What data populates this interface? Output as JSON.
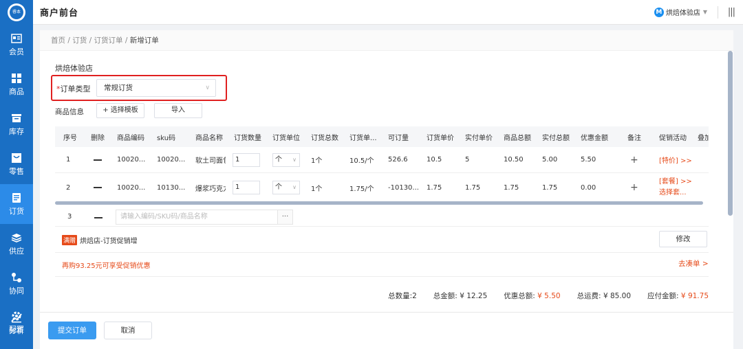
{
  "app": {
    "logo_text": "睿本",
    "title": "商户前台",
    "store_badge": "M",
    "store_name": "烘焙体验店"
  },
  "sidebar": {
    "items": [
      {
        "label": "会员",
        "icon": "member-icon"
      },
      {
        "label": "商品",
        "icon": "goods-icon"
      },
      {
        "label": "库存",
        "icon": "stock-icon"
      },
      {
        "label": "零售",
        "icon": "retail-icon"
      },
      {
        "label": "订货",
        "icon": "order-icon",
        "active": true
      },
      {
        "label": "供应",
        "icon": "supply-icon"
      },
      {
        "label": "协同",
        "icon": "collab-icon"
      },
      {
        "label": "分析",
        "icon": "analysis-icon"
      }
    ],
    "bottom": {
      "label": "配置",
      "icon": "gear-icon"
    }
  },
  "breadcrumb": {
    "home": "首页",
    "sep": "/",
    "order": "订货",
    "order_list": "订货订单",
    "current": "新增订单"
  },
  "form": {
    "store_name": "烘焙体验店",
    "order_type_required": "*",
    "order_type_label": "订单类型",
    "order_type_value": "常规订货",
    "goods_label": "商品信息",
    "template_button": "+ 选择模板",
    "import_button": "导入"
  },
  "table": {
    "headers": [
      "序号",
      "删除",
      "商品编码",
      "sku码",
      "商品名称",
      "订货数量",
      "订货单位",
      "订货总数",
      "订货单...",
      "可订量",
      "订货单价",
      "实付单价",
      "商品总额",
      "实付总额",
      "优惠金额",
      "备注",
      "促销活动",
      "叠加促"
    ],
    "rows": [
      {
        "index": "1",
        "code": "10020...",
        "sku": "10020...",
        "name": "软土司面包",
        "qty": "1",
        "unit": "个",
        "total": "1个",
        "unit_desc": "10.5/个",
        "available": "526.6",
        "price": "10.5",
        "paid_price": "5",
        "goods_total": "10.50",
        "paid_total": "5.00",
        "discount": "5.50",
        "remark": "+",
        "promo1": "[特价] >>",
        "promo2": ""
      },
      {
        "index": "2",
        "code": "10020...",
        "sku": "10130...",
        "name": "爆浆巧克力",
        "qty": "1",
        "unit": "个",
        "total": "1个",
        "unit_desc": "1.75/个",
        "available": "-10130...",
        "price": "1.75",
        "paid_price": "1.75",
        "goods_total": "1.75",
        "paid_total": "1.75",
        "discount": "0.00",
        "remark": "+",
        "promo1": "[套餐] >>",
        "promo2": "选择套..."
      }
    ],
    "new_row": {
      "index": "3",
      "placeholder": "请输入编码/SKU码/商品名称",
      "more": "..."
    }
  },
  "promotion": {
    "badge": "满赠",
    "text": "烘焙店-订货促销增",
    "modify_button": "修改",
    "rebuy_text": "再购93.25元可享受促销优惠",
    "go_collect": "去凑单 >"
  },
  "totals": {
    "qty": "总数量:2",
    "amount_label": "总金额:",
    "amount": "¥ 12.25",
    "discount_label": "优惠总额:",
    "discount": "¥ 5.50",
    "freight_label": "总运费:",
    "freight": "¥ 85.00",
    "payable_label": "应付金额:",
    "payable": "¥ 91.75"
  },
  "actions": {
    "submit": "提交订单",
    "cancel": "取消"
  }
}
